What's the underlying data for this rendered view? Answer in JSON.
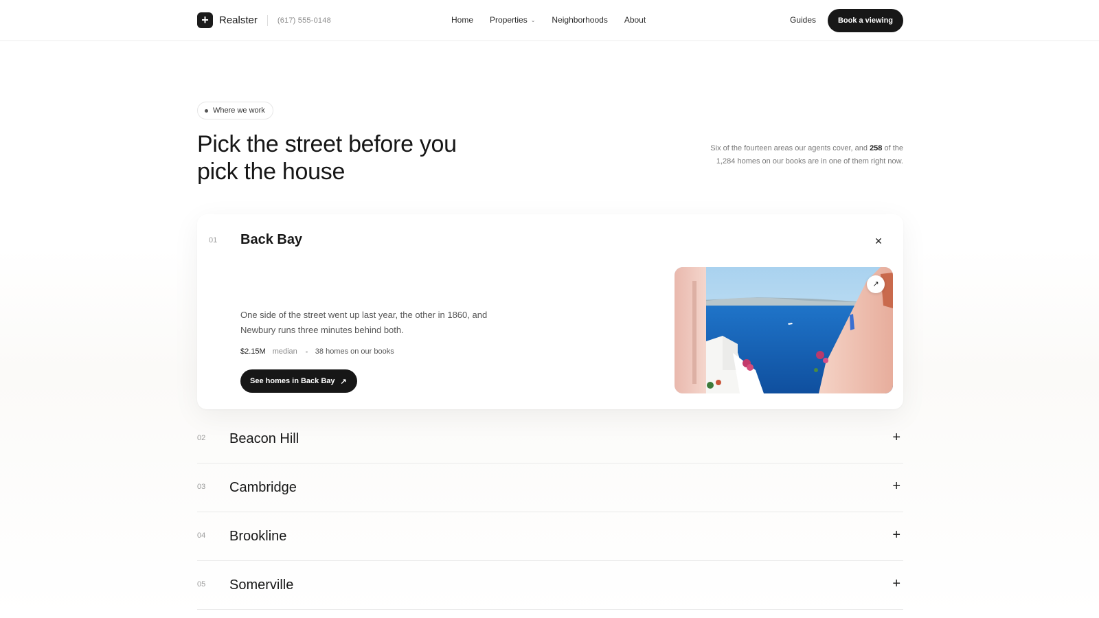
{
  "header": {
    "brand_mark": "+",
    "brand_name": "Realster",
    "phone": "(617) 555-0148",
    "nav": [
      {
        "label": "Home"
      },
      {
        "label": "Properties",
        "has_dropdown": true
      },
      {
        "label": "Neighborhoods"
      },
      {
        "label": "About"
      }
    ],
    "guides_label": "Guides",
    "cta_label": "Book a viewing"
  },
  "hero": {
    "pill_label": "Where we work",
    "title": "Pick the street before you pick the house",
    "desc_before": "Six of the fourteen areas our agents cover, and ",
    "desc_highlight": "258",
    "desc_after": " of the 1,284 homes on our books are in one of them right now."
  },
  "areas": [
    {
      "num": "01",
      "name": "Back Bay",
      "expanded": true,
      "description": "One side of the street went up last year, the other in 1860, and Newbury runs three minutes behind both.",
      "median_price": "$2.15M",
      "median_label": "median",
      "homes": "38 homes on our books",
      "button_label": "See homes in Back Bay"
    },
    {
      "num": "02",
      "name": "Beacon Hill",
      "expanded": false
    },
    {
      "num": "03",
      "name": "Cambridge",
      "expanded": false
    },
    {
      "num": "04",
      "name": "Brookline",
      "expanded": false
    },
    {
      "num": "05",
      "name": "Somerville",
      "expanded": false
    }
  ],
  "icons": {
    "close": "close-icon",
    "expand": "plus-icon",
    "arrow": "arrow-up-right-icon",
    "chevron": "chevron-down-icon"
  },
  "colors": {
    "ink": "#171717",
    "muted": "#8a8a8a",
    "sea": "#1a6fc4"
  }
}
